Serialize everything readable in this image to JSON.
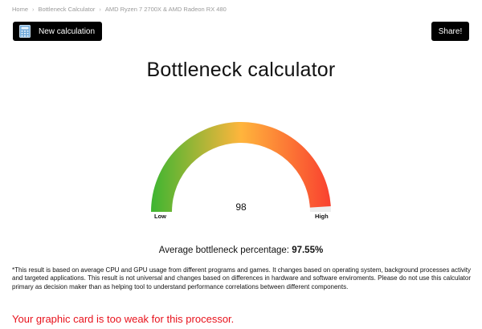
{
  "breadcrumb": {
    "items": [
      "Home",
      "Bottleneck Calculator",
      "AMD Ryzen 7 2700X & AMD Radeon RX 480"
    ],
    "separator": "›"
  },
  "toolbar": {
    "new_calculation_label": "New calculation",
    "new_calculation_icon": "calculator-icon",
    "share_label": "Share!"
  },
  "main": {
    "title": "Bottleneck calculator"
  },
  "gauge": {
    "value": 98,
    "value_text": "98",
    "min": 0,
    "max": 100,
    "low_label": "Low",
    "high_label": "High",
    "colors": [
      "#3db531",
      "#ffb53c",
      "#f9402f"
    ]
  },
  "result": {
    "average_label": "Average bottleneck percentage:",
    "average_value": "97.55%",
    "disclaimer": "*This result is based on average CPU and GPU usage from different programs and games. It changes based on operating system, background processes activity and targeted applications. This result is not universal and changes based on differences in hardware and software enviroments. Please do not use this calculator primary as decision maker than as helping tool to understand performance correlations between different components.",
    "verdict": "Your graphic card is too weak for this processor.",
    "verdict_color": "#e8121c"
  }
}
